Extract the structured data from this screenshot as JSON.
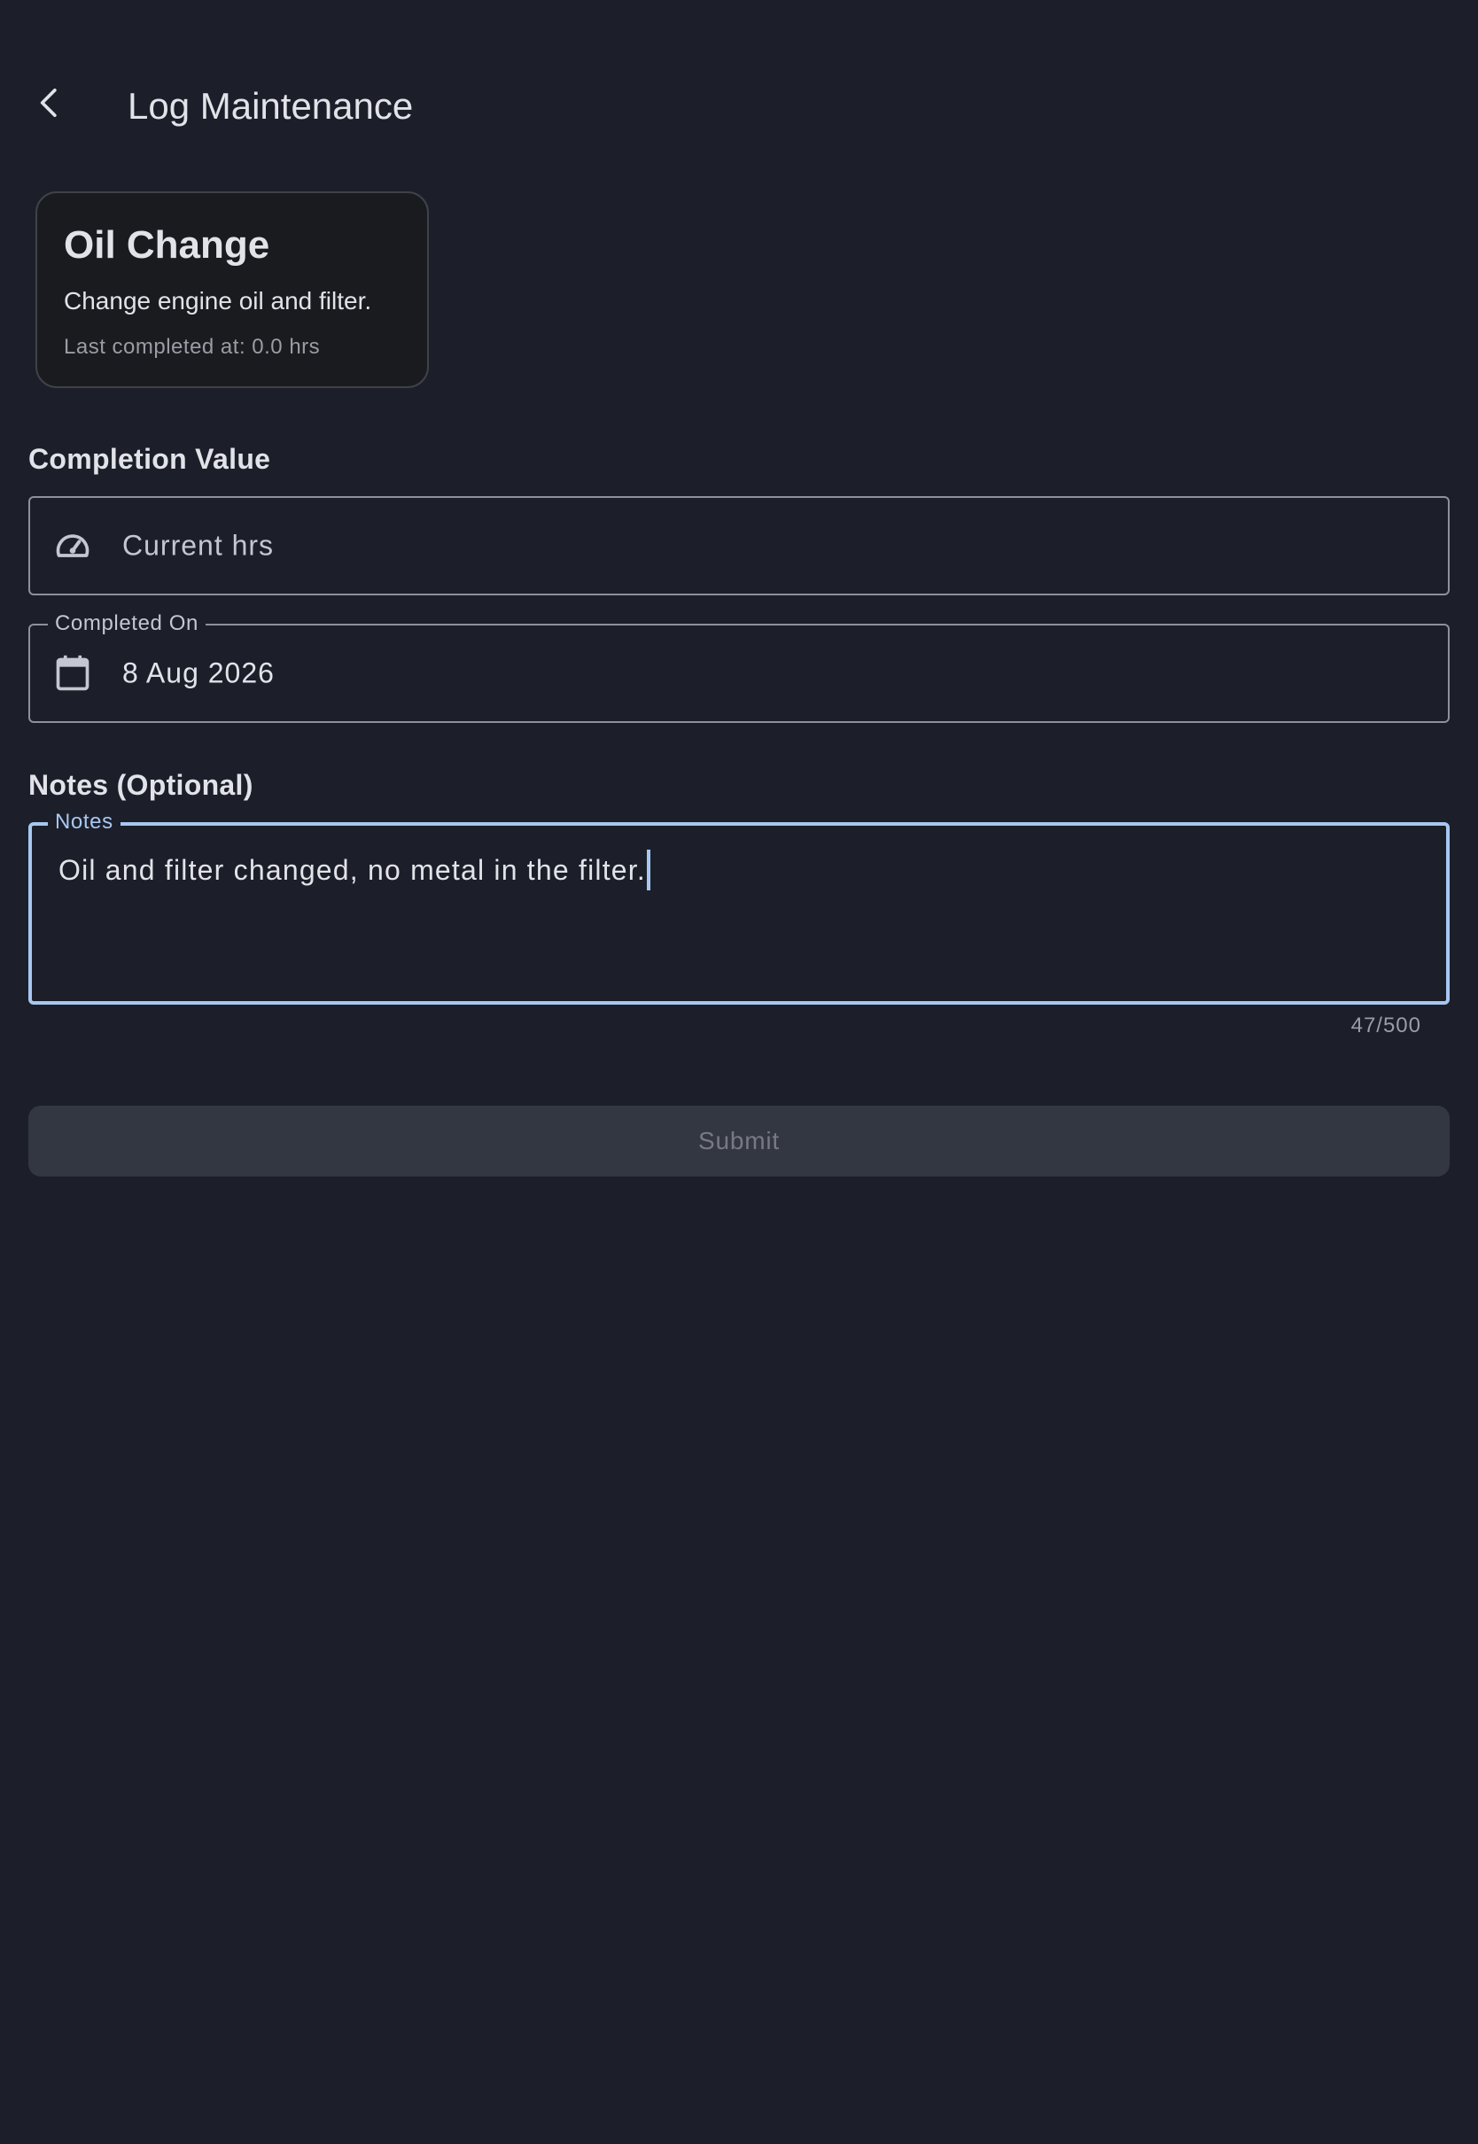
{
  "header": {
    "title": "Log Maintenance",
    "back_icon": "chevron-left-icon"
  },
  "task": {
    "title": "Oil Change",
    "description": "Change engine oil and filter.",
    "last_completed": "Last completed at: 0.0 hrs"
  },
  "completion": {
    "section_label": "Completion Value",
    "icon": "speedometer-icon",
    "placeholder": "Current hrs"
  },
  "completed_on": {
    "label": "Completed On",
    "icon": "calendar-icon",
    "value": "8 Aug 2026"
  },
  "notes": {
    "section_label": "Notes (Optional)",
    "label": "Notes",
    "value": "Oil and filter changed, no metal in the filter.",
    "counter": "47/500"
  },
  "submit": {
    "label": "Submit"
  },
  "colors": {
    "background": "#1c1f29",
    "focus": "#a7c7f2",
    "outline": "#8e919b",
    "button_disabled": "#333742"
  }
}
